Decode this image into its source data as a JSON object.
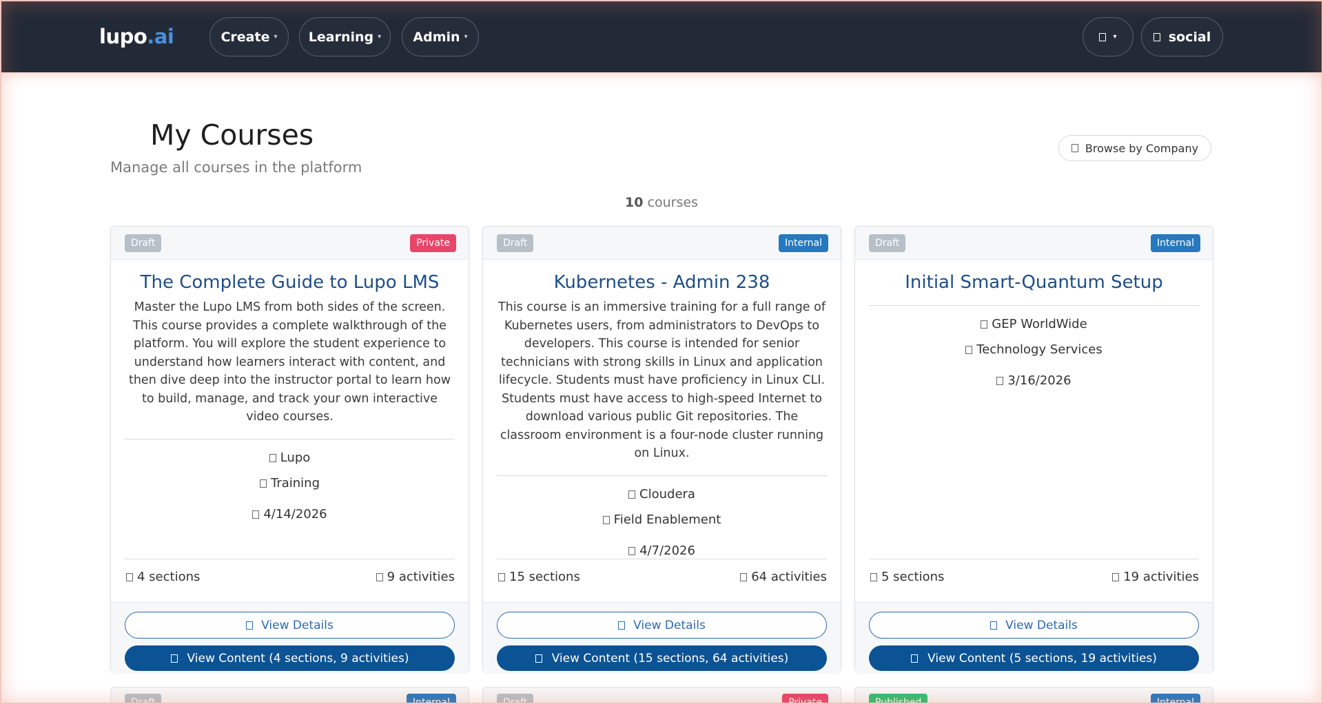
{
  "nav": {
    "brand_main": "lupo",
    "brand_dot": ".",
    "brand_ai": "ai",
    "menus": [
      {
        "label": "Create"
      },
      {
        "label": "Learning"
      },
      {
        "label": "Admin"
      }
    ],
    "user_label": "social",
    "caret": "▾"
  },
  "header": {
    "title": "My Courses",
    "subtitle": "Manage all courses in the platform",
    "browse_label": "Browse by Company"
  },
  "summary": {
    "count": "10",
    "count_suffix": "courses"
  },
  "cards": [
    {
      "status": "Draft",
      "visibility": "Private",
      "title": "The Complete Guide to Lupo LMS",
      "description": "Master the Lupo LMS from both sides of the screen. This course provides a complete walkthrough of the platform. You will explore the student experience to understand how learners interact with content, and then dive deep into the instructor portal to learn how to build, manage, and track your own interactive video courses.",
      "company": "Lupo",
      "category": "Training",
      "date": "4/14/2026",
      "sections": "4 sections",
      "activities": "9 activities",
      "details_label": "View Details",
      "content_label": "View Content (4 sections, 9 activities)"
    },
    {
      "status": "Draft",
      "visibility": "Internal",
      "title": "Kubernetes - Admin 238",
      "description": "This course is an immersive training for a full range of Kubernetes users, from administrators to DevOps to developers. This course is intended for senior technicians with strong skills in Linux and application lifecycle. Students must have proficiency in Linux CLI. Students must have access to high-speed Internet to download various public Git repositories. The classroom environment is a four-node cluster running on Linux.",
      "company": "Cloudera",
      "category": "Field Enablement",
      "date": "4/7/2026",
      "sections": "15 sections",
      "activities": "64 activities",
      "details_label": "View Details",
      "content_label": "View Content (15 sections, 64 activities)"
    },
    {
      "status": "Draft",
      "visibility": "Internal",
      "title": "Initial Smart-Quantum Setup",
      "description": "",
      "company": "GEP WorldWide",
      "category": "Technology Services",
      "date": "3/16/2026",
      "sections": "5 sections",
      "activities": "19 activities",
      "details_label": "View Details",
      "content_label": "View Content (5 sections, 19 activities)"
    }
  ],
  "peek_cards": [
    {
      "status": "Draft",
      "visibility": "Internal"
    },
    {
      "status": "Draft",
      "visibility": "Private"
    },
    {
      "status": "Published",
      "visibility": "Internal"
    }
  ],
  "colors": {
    "nav_bg": "#232a37",
    "brand_accent": "#4a8fdc",
    "title_blue": "#1d4e89",
    "primary": "#0b5394",
    "private_badge": "#e8456a",
    "internal_badge": "#2479c0",
    "draft_badge": "#b7c0c7",
    "published_badge": "#2fbf71"
  }
}
